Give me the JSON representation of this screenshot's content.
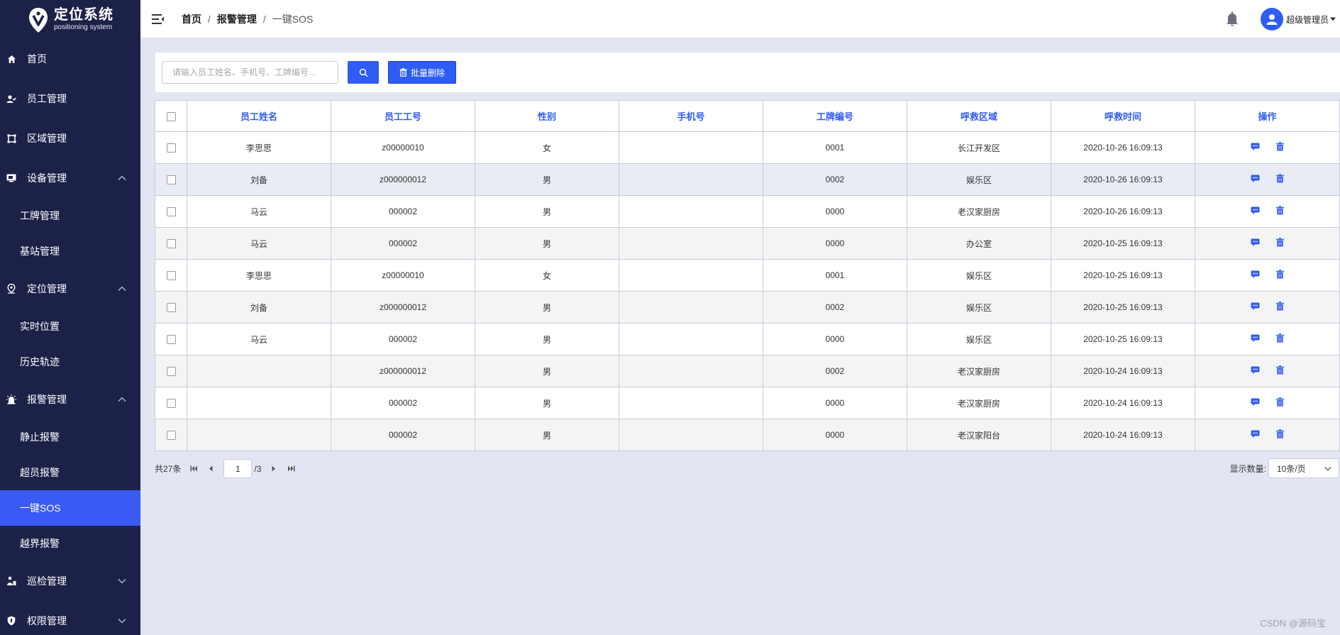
{
  "app": {
    "title": "定位系统",
    "subtitle": "positioning system"
  },
  "sidebar": {
    "items": [
      {
        "label": "首页",
        "icon": "home-icon"
      },
      {
        "label": "员工管理",
        "icon": "users-icon"
      },
      {
        "label": "区域管理",
        "icon": "area-icon"
      },
      {
        "label": "设备管理",
        "icon": "device-icon",
        "expanded": true,
        "children": [
          "工牌管理",
          "基站管理"
        ]
      },
      {
        "label": "定位管理",
        "icon": "location-pin-icon",
        "expanded": true,
        "children": [
          "实时位置",
          "历史轨迹"
        ]
      },
      {
        "label": "报警管理",
        "icon": "alarm-icon",
        "expanded": true,
        "children": [
          "静止报警",
          "超员报警",
          "一键SOS",
          "越界报警"
        ],
        "active_child": "一键SOS"
      },
      {
        "label": "巡检管理",
        "icon": "patrol-icon",
        "expanded": false
      },
      {
        "label": "权限管理",
        "icon": "shield-icon",
        "expanded": false
      }
    ]
  },
  "header": {
    "breadcrumb": [
      "首页",
      "报警管理",
      "一键SOS"
    ],
    "separator": "/",
    "user_name": "超级管理员"
  },
  "toolbar": {
    "search_placeholder": "请输入员工姓名、手机号、工牌编号...",
    "bulk_delete_label": "批量删除"
  },
  "table": {
    "columns": [
      "员工姓名",
      "员工工号",
      "性别",
      "手机号",
      "工牌编号",
      "呼救区域",
      "呼救时间",
      "操作"
    ],
    "rows": [
      [
        "李思思",
        "z00000010",
        "女",
        "",
        "0001",
        "长江开发区",
        "2020-10-26 16:09:13"
      ],
      [
        "刘备",
        "z000000012",
        "男",
        "",
        "0002",
        "娱乐区",
        "2020-10-26 16:09:13"
      ],
      [
        "马云",
        "000002",
        "男",
        "",
        "0000",
        "老汉家厨房",
        "2020-10-26 16:09:13"
      ],
      [
        "马云",
        "000002",
        "男",
        "",
        "0000",
        "办公室",
        "2020-10-25 16:09:13"
      ],
      [
        "李思思",
        "z00000010",
        "女",
        "",
        "0001",
        "娱乐区",
        "2020-10-25 16:09:13"
      ],
      [
        "刘备",
        "z000000012",
        "男",
        "",
        "0002",
        "娱乐区",
        "2020-10-25 16:09:13"
      ],
      [
        "马云",
        "000002",
        "男",
        "",
        "0000",
        "娱乐区",
        "2020-10-25 16:09:13"
      ],
      [
        "",
        "z000000012",
        "男",
        "",
        "0002",
        "老汉家厨房",
        "2020-10-24 16:09:13"
      ],
      [
        "",
        "000002",
        "男",
        "",
        "0000",
        "老汉家厨房",
        "2020-10-24 16:09:13"
      ],
      [
        "",
        "000002",
        "男",
        "",
        "0000",
        "老汉家阳台",
        "2020-10-24 16:09:13"
      ]
    ]
  },
  "pager": {
    "total_label": "共27条",
    "current_page": "1",
    "total_pages_label": "/3",
    "page_size_label": "显示数量:",
    "page_size_value": "10条/页"
  },
  "watermark": "CSDN @源码宝",
  "colors": {
    "sidebar_bg": "#1c2148",
    "accent": "#2f5cf5",
    "active_item": "#3a5af5",
    "page_bg": "#e3e6f2"
  }
}
